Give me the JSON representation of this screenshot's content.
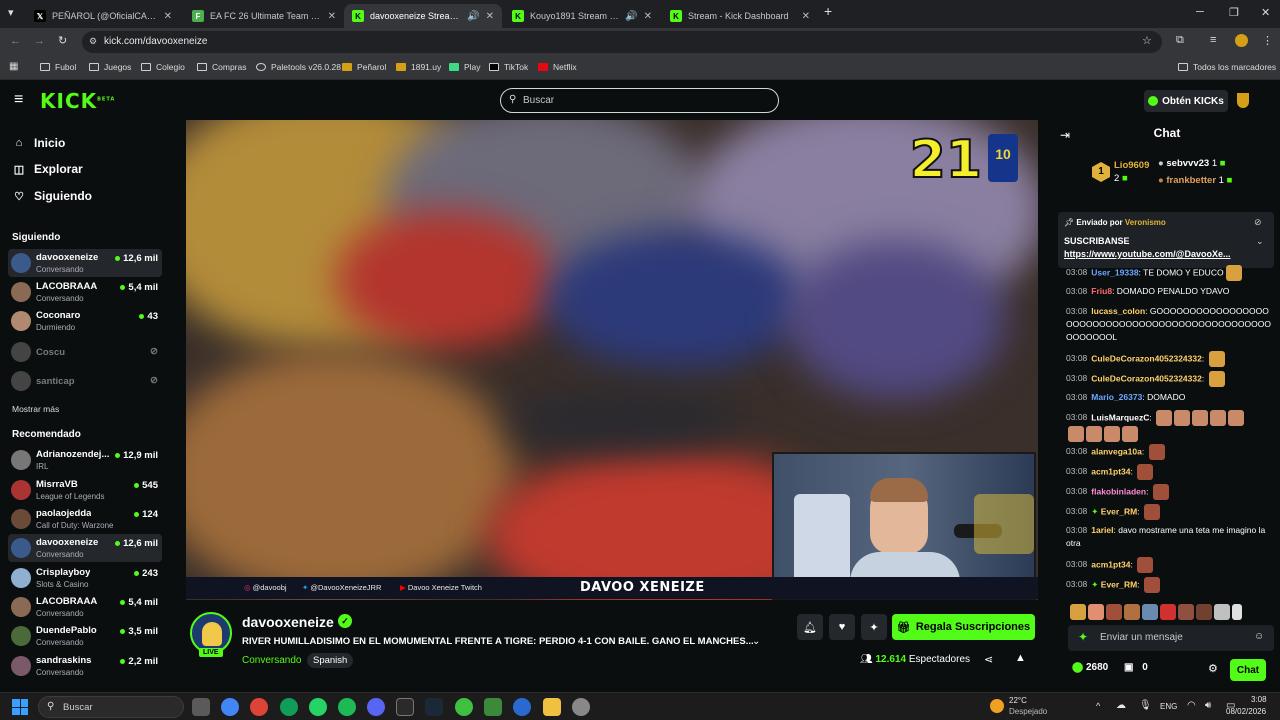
{
  "browser": {
    "tabs": [
      {
        "label": "PEÑAROL (@OficialCAP) / X",
        "icon": "x-logo"
      },
      {
        "label": "EA FC 26 Ultimate Team Prices",
        "icon": "futbin-icon"
      },
      {
        "label": "davooxeneize Stream - Watc",
        "icon": "kick-icon"
      },
      {
        "label": "Kouyo1891 Stream - Watch",
        "icon": "kick-icon"
      },
      {
        "label": "Stream - Kick Dashboard",
        "icon": "kick-icon"
      }
    ],
    "url": "kick.com/davooxeneize",
    "bookmarks": [
      "Fubol",
      "Juegos",
      "Colegio",
      "Compras",
      "Paletools v26.0.28",
      "Peñarol",
      "1891.uy",
      "Play",
      "TikTok",
      "Netflix"
    ],
    "all_bookmarks": "Todos los marcadores"
  },
  "header": {
    "logo": "KICK",
    "logo_badge": "BETA",
    "search_placeholder": "Buscar",
    "get_kicks": "Obtén KICKs"
  },
  "sidebar": {
    "nav": [
      {
        "label": "Inicio",
        "icon": "home-icon"
      },
      {
        "label": "Explorar",
        "icon": "compass-icon"
      },
      {
        "label": "Siguiendo",
        "icon": "heart-icon"
      }
    ],
    "following_title": "Siguiendo",
    "following": [
      {
        "name": "davooxeneize",
        "sub": "Conversando",
        "viewers": "12,6 mil",
        "online": true,
        "color": "#3b5a8c"
      },
      {
        "name": "LACOBRAAA",
        "sub": "Conversando",
        "viewers": "5,4 mil",
        "online": true,
        "color": "#8a6a55"
      },
      {
        "name": "Coconaro",
        "sub": "Durmiendo",
        "viewers": "43",
        "online": true,
        "color": "#b08970"
      },
      {
        "name": "Coscu",
        "sub": "",
        "viewers": "",
        "online": false,
        "color": "#555"
      },
      {
        "name": "santicap",
        "sub": "",
        "viewers": "",
        "online": false,
        "color": "#555"
      }
    ],
    "show_more": "Mostrar más",
    "recommended_title": "Recomendado",
    "recommended": [
      {
        "name": "Adrianozendej...",
        "sub": "IRL",
        "viewers": "12,9 mil",
        "color": "#777"
      },
      {
        "name": "MisrraVB",
        "sub": "League of Legends",
        "viewers": "545",
        "color": "#a33"
      },
      {
        "name": "paolaojedda",
        "sub": "Call of Duty: Warzone",
        "viewers": "124",
        "color": "#6b4a3a"
      },
      {
        "name": "davooxeneize",
        "sub": "Conversando",
        "viewers": "12,6 mil",
        "color": "#3b5a8c"
      },
      {
        "name": "Crisplayboy",
        "sub": "Slots & Casino",
        "viewers": "243",
        "color": "#8fb0d0"
      },
      {
        "name": "LACOBRAAA",
        "sub": "Conversando",
        "viewers": "5,4 mil",
        "color": "#8a6a55"
      },
      {
        "name": "DuendePablo",
        "sub": "Conversando",
        "viewers": "3,5 mil",
        "color": "#4a6a3a"
      },
      {
        "name": "sandraskins",
        "sub": "Conversando",
        "viewers": "2,2 mil",
        "color": "#7a5a6a"
      }
    ]
  },
  "video": {
    "score": "21",
    "jersey_number": "10",
    "socials": [
      "@davoobj",
      "@DavooXeneizeJRR",
      "Davoo Xeneize Twitch"
    ],
    "overlay_name": "DAVOO XENEIZE"
  },
  "stream": {
    "channel": "davooxeneize",
    "live": "LIVE",
    "title": "RIVER HUMILLADISIMO EN EL MOMUMENTAL FRENTE A TIGRE: PERDIO 4-1 CON BAILE. GANO EL MANCHES...",
    "category": "Conversando",
    "tag": "Spanish",
    "subscribe": "Regala Suscripciones",
    "viewers": "12.614",
    "viewers_label": "Espectadores"
  },
  "chat": {
    "title": "Chat",
    "gifters": [
      {
        "name": "Lio9609",
        "count": "2",
        "rank": "1"
      },
      {
        "name": "sebvvv23",
        "count": "1"
      },
      {
        "name": "frankbetter",
        "count": "1"
      }
    ],
    "pinned": {
      "sent_by_label": "Enviado por",
      "sent_by": "Veronismo",
      "text": "SUSCRIBANSE",
      "link": "https://www.youtube.com/@DavooXe..."
    },
    "messages": [
      {
        "time": "03:08",
        "user": "User_19338",
        "color": "#6aa8ff",
        "text": "TE DOMO Y EDUCO"
      },
      {
        "time": "03:08",
        "user": "Friu8",
        "color": "#ff6b6b",
        "text": "DOMADO PENALDO YDAVO"
      },
      {
        "time": "03:08",
        "user": "lucass_colon",
        "color": "#ffd36a",
        "text": "GOOOOOOOOOOOOOOOOOOOOOOOOOOOOOOOOOOOOOOOOOOOOOOOOOOOOOOOL"
      },
      {
        "time": "03:08",
        "user": "CuleDeCorazon4052324332",
        "color": "#ffd36a",
        "text": ""
      },
      {
        "time": "03:08",
        "user": "CuleDeCorazon4052324332",
        "color": "#ffd36a",
        "text": ""
      },
      {
        "time": "03:08",
        "user": "Mario_26373",
        "color": "#6aa8ff",
        "text": "DOMADO"
      },
      {
        "time": "03:08",
        "user": "LuisMarquezC",
        "color": "#ffffff",
        "text": ""
      },
      {
        "time": "03:08",
        "user": "alanvega10a",
        "color": "#ffd36a",
        "text": ""
      },
      {
        "time": "03:08",
        "user": "acm1pt34",
        "color": "#ffd36a",
        "text": ""
      },
      {
        "time": "03:08",
        "user": "flakobinladen",
        "color": "#ff8ad8",
        "text": ""
      },
      {
        "time": "03:08",
        "user": "Ever_RM",
        "color": "#ffd36a",
        "text": ""
      },
      {
        "time": "03:08",
        "user": "1ariel",
        "color": "#ffd36a",
        "text": "davo mostrame una teta me imagino la otra"
      },
      {
        "time": "03:08",
        "user": "acm1pt34",
        "color": "#ffd36a",
        "text": ""
      },
      {
        "time": "03:08",
        "user": "Ever_RM",
        "color": "#ffd36a",
        "text": ""
      }
    ],
    "input_placeholder": "Enviar un mensaje",
    "points": "2680",
    "gifts": "0",
    "send": "Chat"
  },
  "taskbar": {
    "search_placeholder": "Buscar",
    "weather_temp": "22°C",
    "weather_desc": "Despejado",
    "lang": "ENG",
    "time": "3:08",
    "date": "08/02/2026"
  }
}
